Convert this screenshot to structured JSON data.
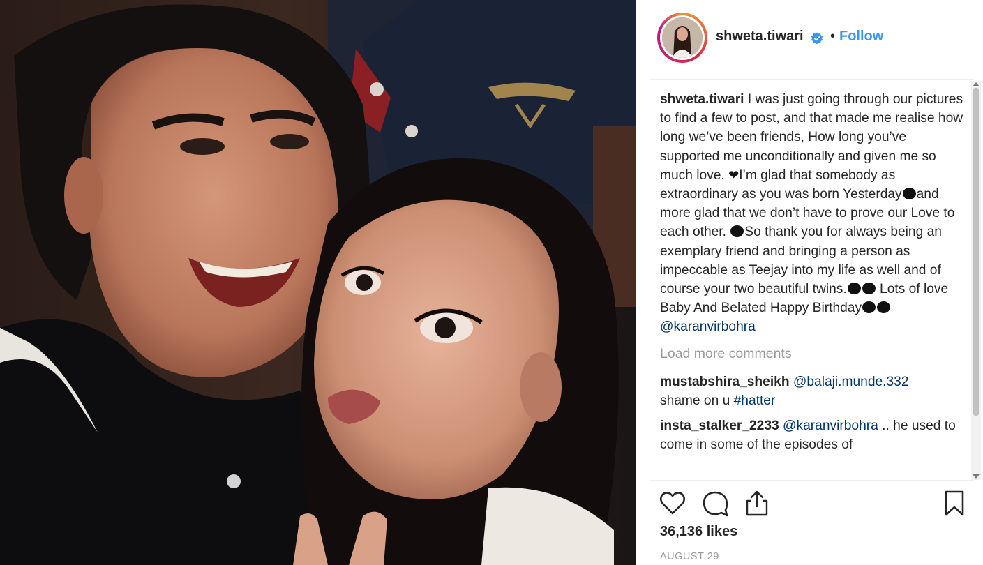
{
  "post": {
    "username": "shweta.tiwari",
    "verified": true,
    "separator": "•",
    "follow_label": "Follow"
  },
  "caption": {
    "username": "shweta.tiwari",
    "text_1": " I was just going through our pictures to find a few to post, and that made me realise how long we’ve been friends, How long you’ve supported me unconditionally and given me so much love. ",
    "heart": "❤",
    "text_2": "I’m glad that somebody as extraordinary as you was born Yesterday",
    "text_3": "and more glad that we don’t have to prove our Love to each other. ",
    "text_4": "So thank you for always being an exemplary friend and bringing a person as impeccable as Teejay into my life as well and of course your two beautiful twins.",
    "text_5": " Lots of love Baby And Belated Happy Birthday",
    "text_6": " ",
    "mention": "@karanvirbohra"
  },
  "load_more": "Load more comments",
  "comments": [
    {
      "username": "mustabshira_sheikh",
      "mention": "@balaji.munde.332",
      "text": "shame on u ",
      "hashtag": "#hatter"
    },
    {
      "username": "insta_stalker_2233",
      "mention": "@karanvirbohra",
      "text": " .. he used to come in some of the episodes of"
    }
  ],
  "likes": "36,136 likes",
  "date": "AUGUST 29",
  "icons": {
    "like": "heart-outline-icon",
    "comment": "comment-bubble-icon",
    "share": "share-icon",
    "save": "bookmark-icon",
    "verified": "verified-badge-icon"
  },
  "colors": {
    "link": "#003569",
    "follow": "#3897f0",
    "verified": "#3897f0",
    "muted": "#999999",
    "text": "#262626"
  }
}
